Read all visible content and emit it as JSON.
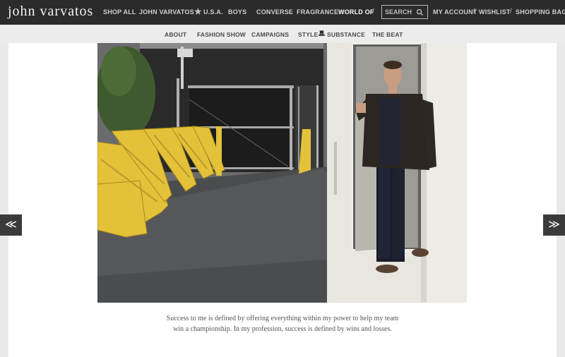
{
  "header": {
    "logo": "john varvatos",
    "nav": [
      {
        "label": "SHOP ALL"
      },
      {
        "label": "JOHN VARVATOS"
      },
      {
        "label": "U.S.A."
      },
      {
        "label": "BOYS"
      },
      {
        "label": "CONVERSE"
      },
      {
        "label": "FRAGRANCE"
      },
      {
        "label": "WORLD OF"
      }
    ],
    "search_label": "SEARCH",
    "account": [
      "MY ACCOUNT",
      "WISHLIST",
      "SHOPPING BAG"
    ]
  },
  "subnav": {
    "items": [
      "ABOUT",
      "FASHION SHOW",
      "CAMPAIGNS",
      "STYLE",
      "SUBSTANCE",
      "THE BEAT"
    ]
  },
  "caption": {
    "line1": "Success to me is defined by offering everything within my power to help my team",
    "line2": "win a championship. In my profession, success is defined by wins and losses."
  },
  "arrows": {
    "prev": "≪",
    "next": "≫"
  },
  "icons": {
    "star": "star-icon",
    "search": "magnifier-icon",
    "hat": "top-hat-icon"
  },
  "colors": {
    "topbar": "#2b2b2b",
    "subnav": "#ececec",
    "page": "#e9e9e9",
    "arrow": "#3a3a3a"
  }
}
